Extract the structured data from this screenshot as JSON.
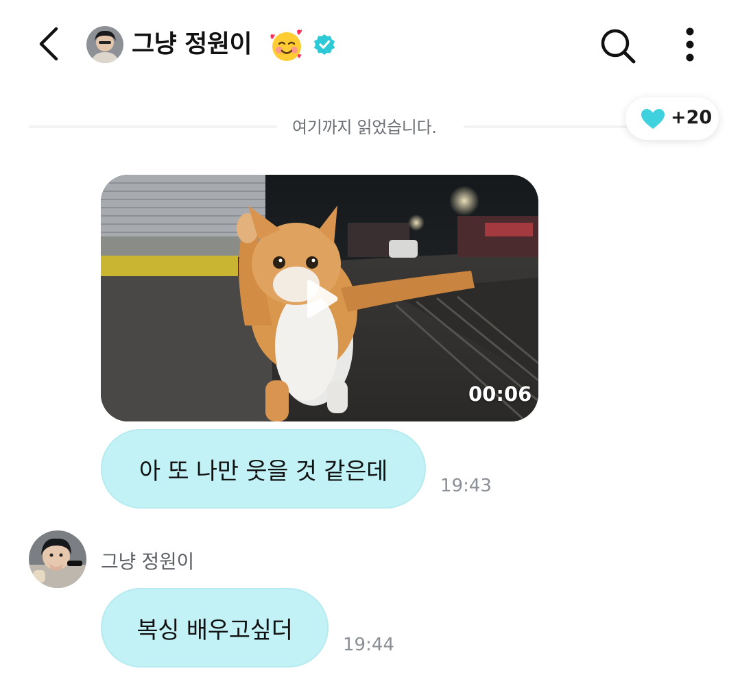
{
  "header": {
    "back_icon": "chevron-left-icon",
    "title": "그냥 정원이",
    "title_emoji": "smiling-face-with-hearts-emoji",
    "verified_icon": "verified-badge-icon",
    "search_icon": "search-icon",
    "more_icon": "more-vertical-icon",
    "accent_color": "#2ec9d6"
  },
  "read_marker": {
    "text": "여기까지 읽었습니다."
  },
  "heart_pill": {
    "icon": "heart-icon",
    "count": "+20",
    "color": "#3fd2de"
  },
  "messages": [
    {
      "type": "video",
      "duration": "00:06",
      "play_icon": "play-icon"
    },
    {
      "type": "text",
      "text": "아 또 나만 웃을 것 같은데",
      "time": "19:43"
    },
    {
      "type": "text",
      "sender": "그냥 정원이",
      "text": "복싱 배우고싶더",
      "time": "19:44"
    }
  ],
  "colors": {
    "bubble_bg": "#c2f2f6",
    "time_text": "#8a8f95"
  }
}
